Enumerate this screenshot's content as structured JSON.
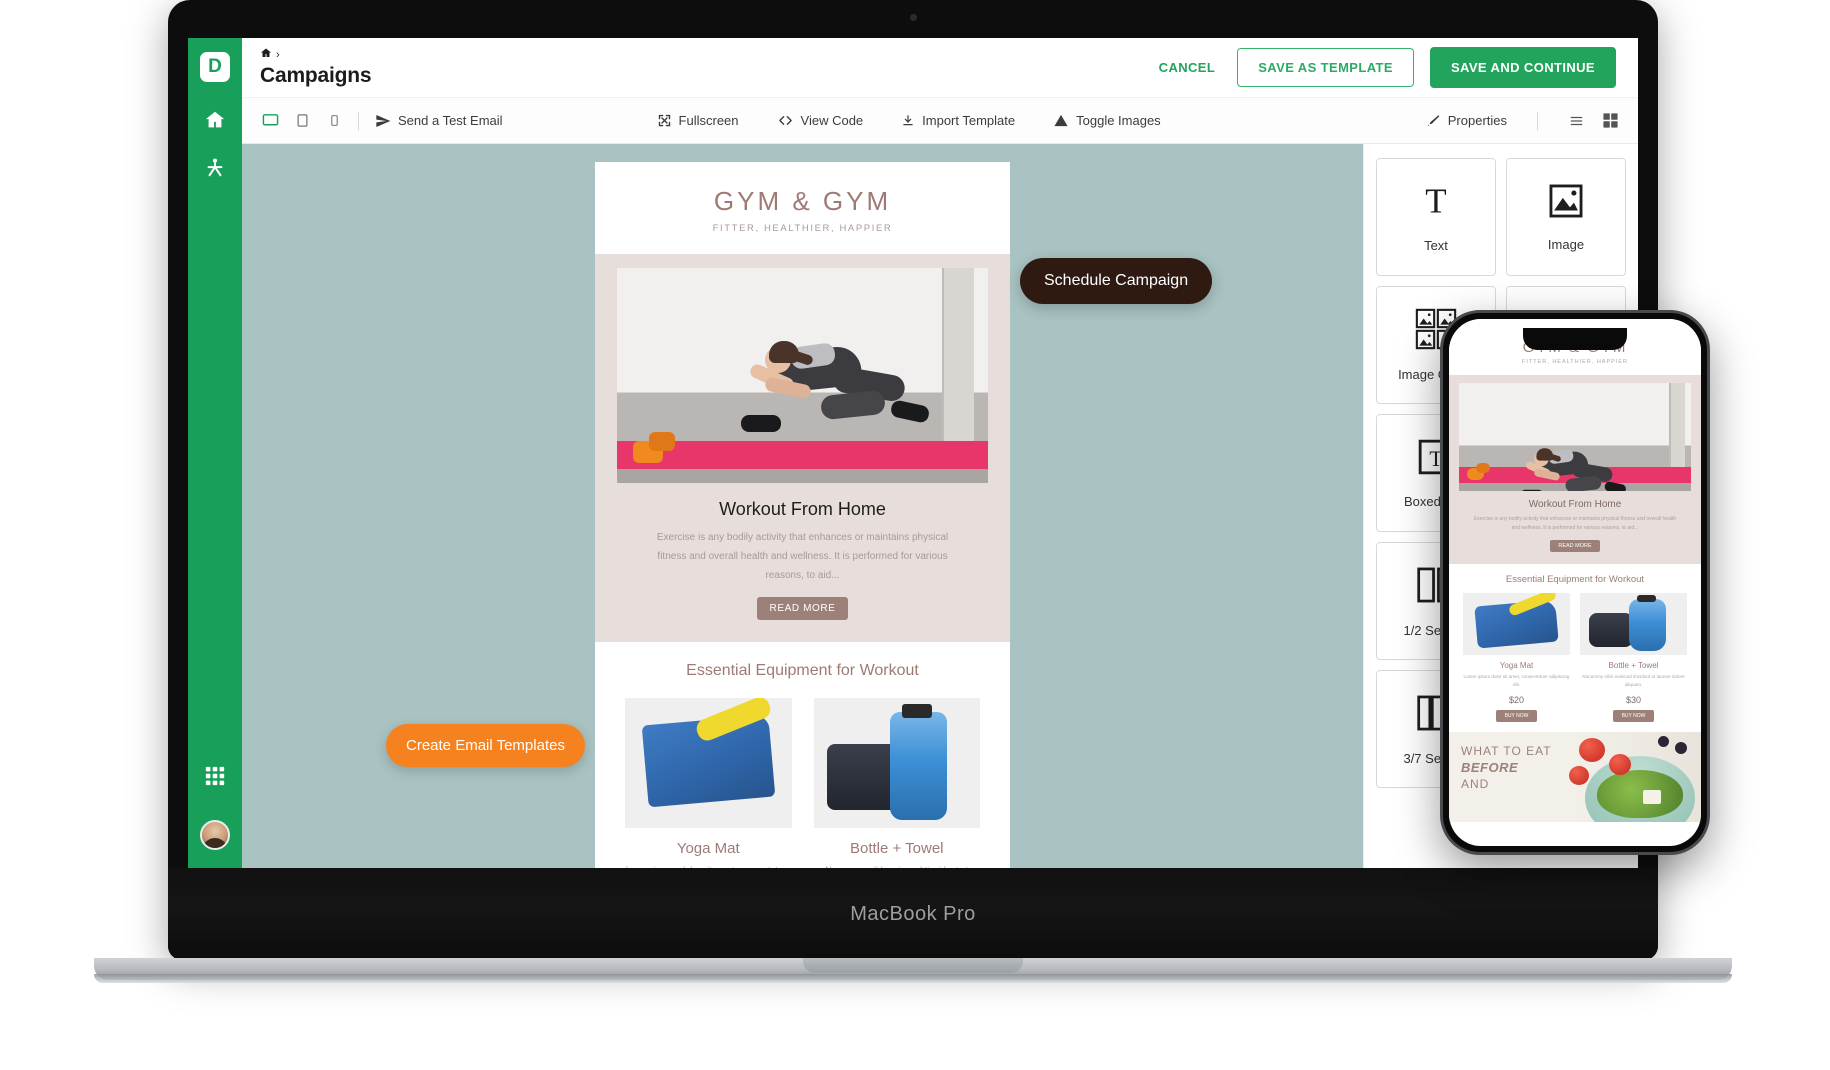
{
  "device": {
    "laptop_brand": "MacBook Pro"
  },
  "rail": {
    "logo": "D",
    "items": [
      {
        "name": "home-icon",
        "label": "Home"
      },
      {
        "name": "automation-icon",
        "label": "Automation"
      },
      {
        "name": "apps-grid-icon",
        "label": "Apps"
      },
      {
        "name": "user-avatar",
        "label": "Account"
      }
    ]
  },
  "header": {
    "breadcrumb_home": "⌂",
    "breadcrumb_sep": "›",
    "title": "Campaigns",
    "cancel_label": "CANCEL",
    "save_template_label": "SAVE AS TEMPLATE",
    "save_continue_label": "SAVE AND CONTINUE"
  },
  "toolbar": {
    "devices": [
      {
        "name": "desktop-view-icon",
        "label": "Desktop",
        "active": true
      },
      {
        "name": "tablet-view-icon",
        "label": "Tablet",
        "active": false
      },
      {
        "name": "mobile-view-icon",
        "label": "Mobile",
        "active": false
      }
    ],
    "send_test_label": "Send a Test Email",
    "fullscreen_label": "Fullscreen",
    "view_code_label": "View Code",
    "import_template_label": "Import Template",
    "toggle_images_label": "Toggle Images",
    "properties_label": "Properties",
    "list_view_label": "List view",
    "grid_view_label": "Grid view"
  },
  "tooltips": {
    "orange": "Create Email Templates",
    "dark": "Schedule Campaign"
  },
  "blocks_panel": {
    "items": [
      {
        "label": "Text",
        "icon": "text-block-icon"
      },
      {
        "label": "Image",
        "icon": "image-block-icon"
      },
      {
        "label": "Image Group",
        "icon": "image-group-block-icon"
      },
      {
        "label": "Boxed Text",
        "icon": "boxed-text-block-icon"
      },
      {
        "label": "1/2 Section",
        "icon": "half-section-block-icon"
      },
      {
        "label": "3/7 Section",
        "icon": "three-seven-section-block-icon"
      }
    ]
  },
  "email": {
    "brand": "GYM & GYM",
    "tagline": "FITTER, HEALTHIER, HAPPIER",
    "hero_heading": "Workout From Home",
    "hero_body": "Exercise is any bodily activity that enhances or maintains physical fitness and overall health and wellness. It is performed for various reasons, to aid...",
    "read_more_label": "READ MORE",
    "section_heading": "Essential Equipment for Workout",
    "products": [
      {
        "name": "Yoga Mat",
        "desc": "Lorem ipsum dolor sit amet, consectetuer adipiscing elit.",
        "price": "$20",
        "buy_label": "BUY NOW"
      },
      {
        "name": "Bottle + Towel",
        "desc": "Nonummy nibh euismod tincidunt ut laoreet dolore aliquam.",
        "price": "$30",
        "buy_label": "BUY NOW"
      }
    ],
    "food_banner": {
      "line1": "WHAT TO EAT",
      "line2": "BEFORE",
      "line3": "AND"
    }
  },
  "colors": {
    "brand_green": "#18A05A",
    "button_green": "#22a45d",
    "canvas_blue": "#a8c3c2",
    "tooltip_orange": "#F6821F",
    "tooltip_dark": "#2E1A11",
    "email_mauve": "#9d7b74"
  }
}
